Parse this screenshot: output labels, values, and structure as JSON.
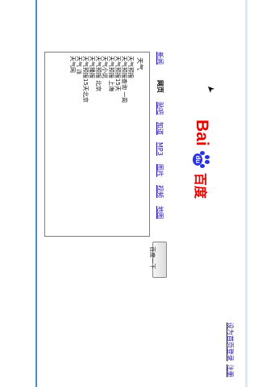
{
  "colors": {
    "accent_bar": "#3b8fd9",
    "link": "#1a0dab",
    "baidu_red": "#e10601",
    "baidu_blue": "#2932e1"
  },
  "search": {
    "query": "天气",
    "placeholder": "",
    "submit_label": "百度一下"
  },
  "suggestions": [
    "天气预报",
    "天气预报查询 一周",
    "天气预报15天",
    "天气预报 上海",
    "天气小说",
    "天气预报 北京",
    "天气播报",
    "天气预报15天北京",
    "天气 派",
    "天气网"
  ],
  "nav": [
    "新闻",
    "网页",
    "贴吧",
    "知道",
    "MP3",
    "图片",
    "视频",
    "地图"
  ],
  "logo": {
    "text_latin": "Bai",
    "text_du": "du",
    "text_cn": "百度"
  },
  "footer": [
    "设为首页",
    "登录",
    "注册"
  ]
}
